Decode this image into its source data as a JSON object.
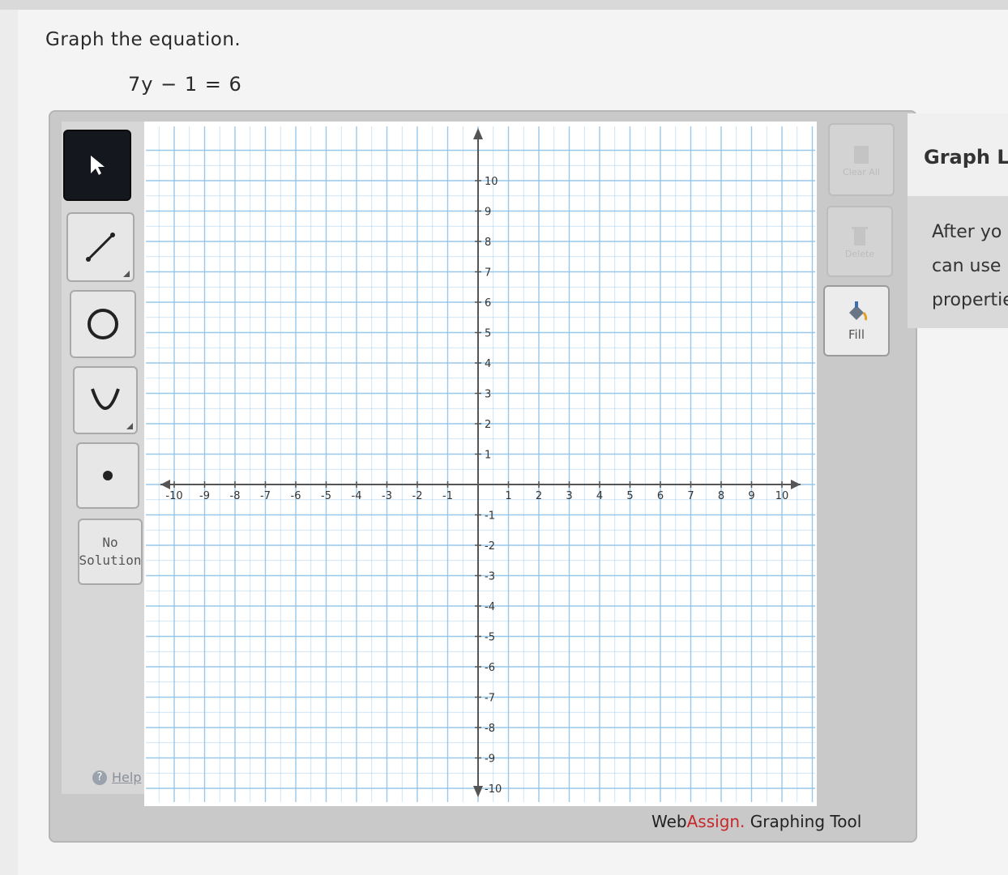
{
  "question": {
    "title": "Graph the equation.",
    "equation": "7y − 1 = 6"
  },
  "toolbar": {
    "tools": [
      {
        "name": "pointer",
        "icon": "arrow-pointer-icon",
        "active": true
      },
      {
        "name": "line",
        "icon": "line-tool-icon",
        "active": false
      },
      {
        "name": "circle",
        "icon": "circle-tool-icon",
        "active": false
      },
      {
        "name": "parabola",
        "icon": "parabola-tool-icon",
        "active": false
      },
      {
        "name": "point",
        "icon": "point-tool-icon",
        "active": false
      }
    ],
    "no_solution_line1": "No",
    "no_solution_line2": "Solution",
    "help_label": "Help"
  },
  "graph": {
    "x_range": [
      -10,
      10
    ],
    "y_range": [
      -10,
      10
    ],
    "x_ticks": [
      "-10",
      "-9",
      "-8",
      "-7",
      "-6",
      "-5",
      "-4",
      "-3",
      "-2",
      "-1",
      "1",
      "2",
      "3",
      "4",
      "5",
      "6",
      "7",
      "8",
      "9",
      "10"
    ],
    "y_ticks": [
      "10",
      "9",
      "8",
      "7",
      "6",
      "5",
      "4",
      "3",
      "2",
      "1",
      "-1",
      "-2",
      "-3",
      "-4",
      "-5",
      "-6",
      "-7",
      "-8",
      "-9",
      "-10"
    ],
    "grid_color": "#8fc3e8",
    "axis_color": "#555555"
  },
  "side_buttons": {
    "clear_all": "Clear All",
    "delete": "Delete",
    "fill": "Fill"
  },
  "brand": {
    "web": "Web",
    "assign": "Assign.",
    "tool": " Graphing Tool"
  },
  "info_panel": {
    "title": "Graph La",
    "line1": "After yo",
    "line2": "can use",
    "line3": "propertie"
  }
}
